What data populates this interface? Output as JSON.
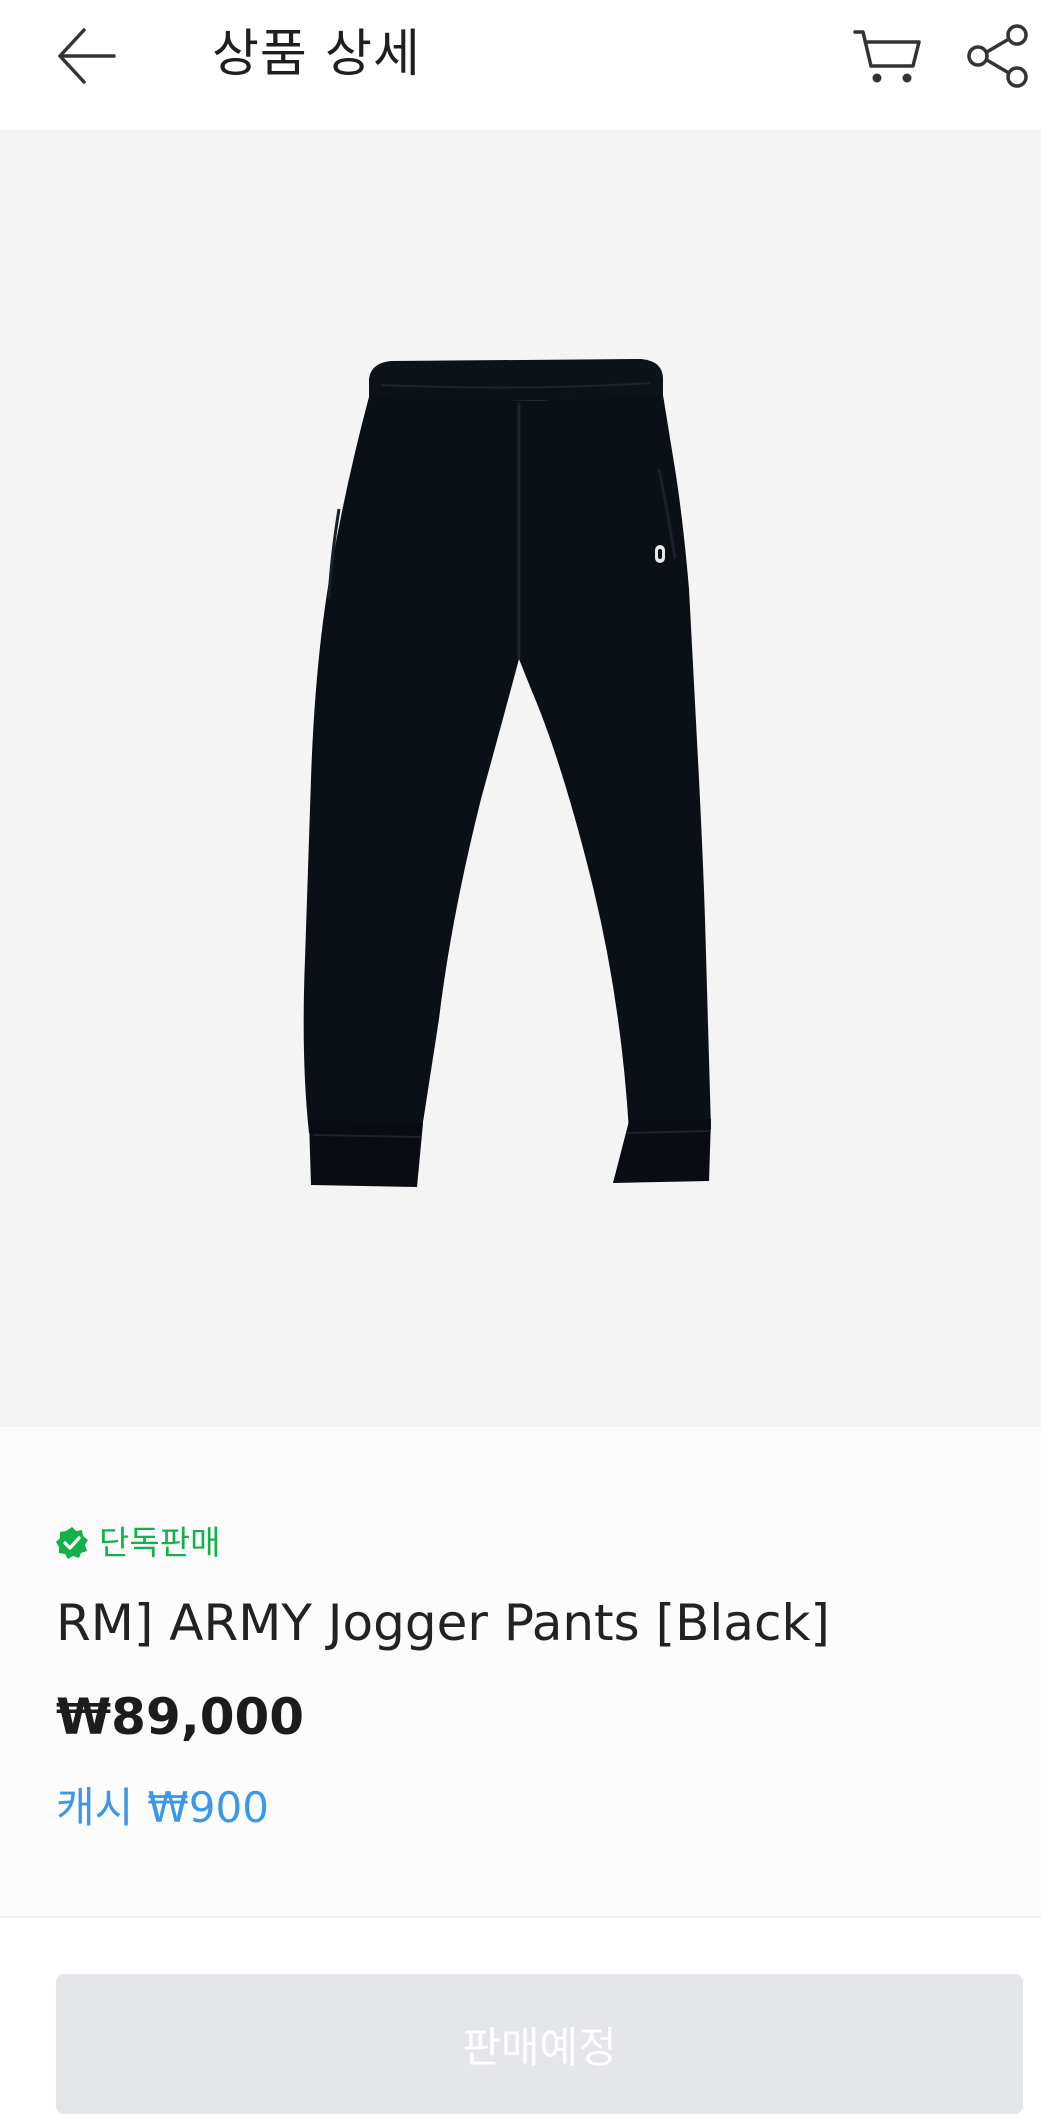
{
  "header": {
    "title": "상품 상세",
    "back_icon": "arrow-left-icon",
    "cart_icon": "cart-icon",
    "share_icon": "share-icon"
  },
  "product": {
    "image_icon": "jogger-pants-image",
    "badge": {
      "icon": "verified-badge-icon",
      "label": "단독판매",
      "color": "#12b24a"
    },
    "name": "RM] ARMY Jogger Pants [Black]",
    "price": "₩89,000",
    "cash": {
      "label": "캐시",
      "value": "₩900",
      "color": "#3a98e6"
    }
  },
  "bottom": {
    "button_label": "판매예정",
    "button_color": "#e4e6e9"
  }
}
